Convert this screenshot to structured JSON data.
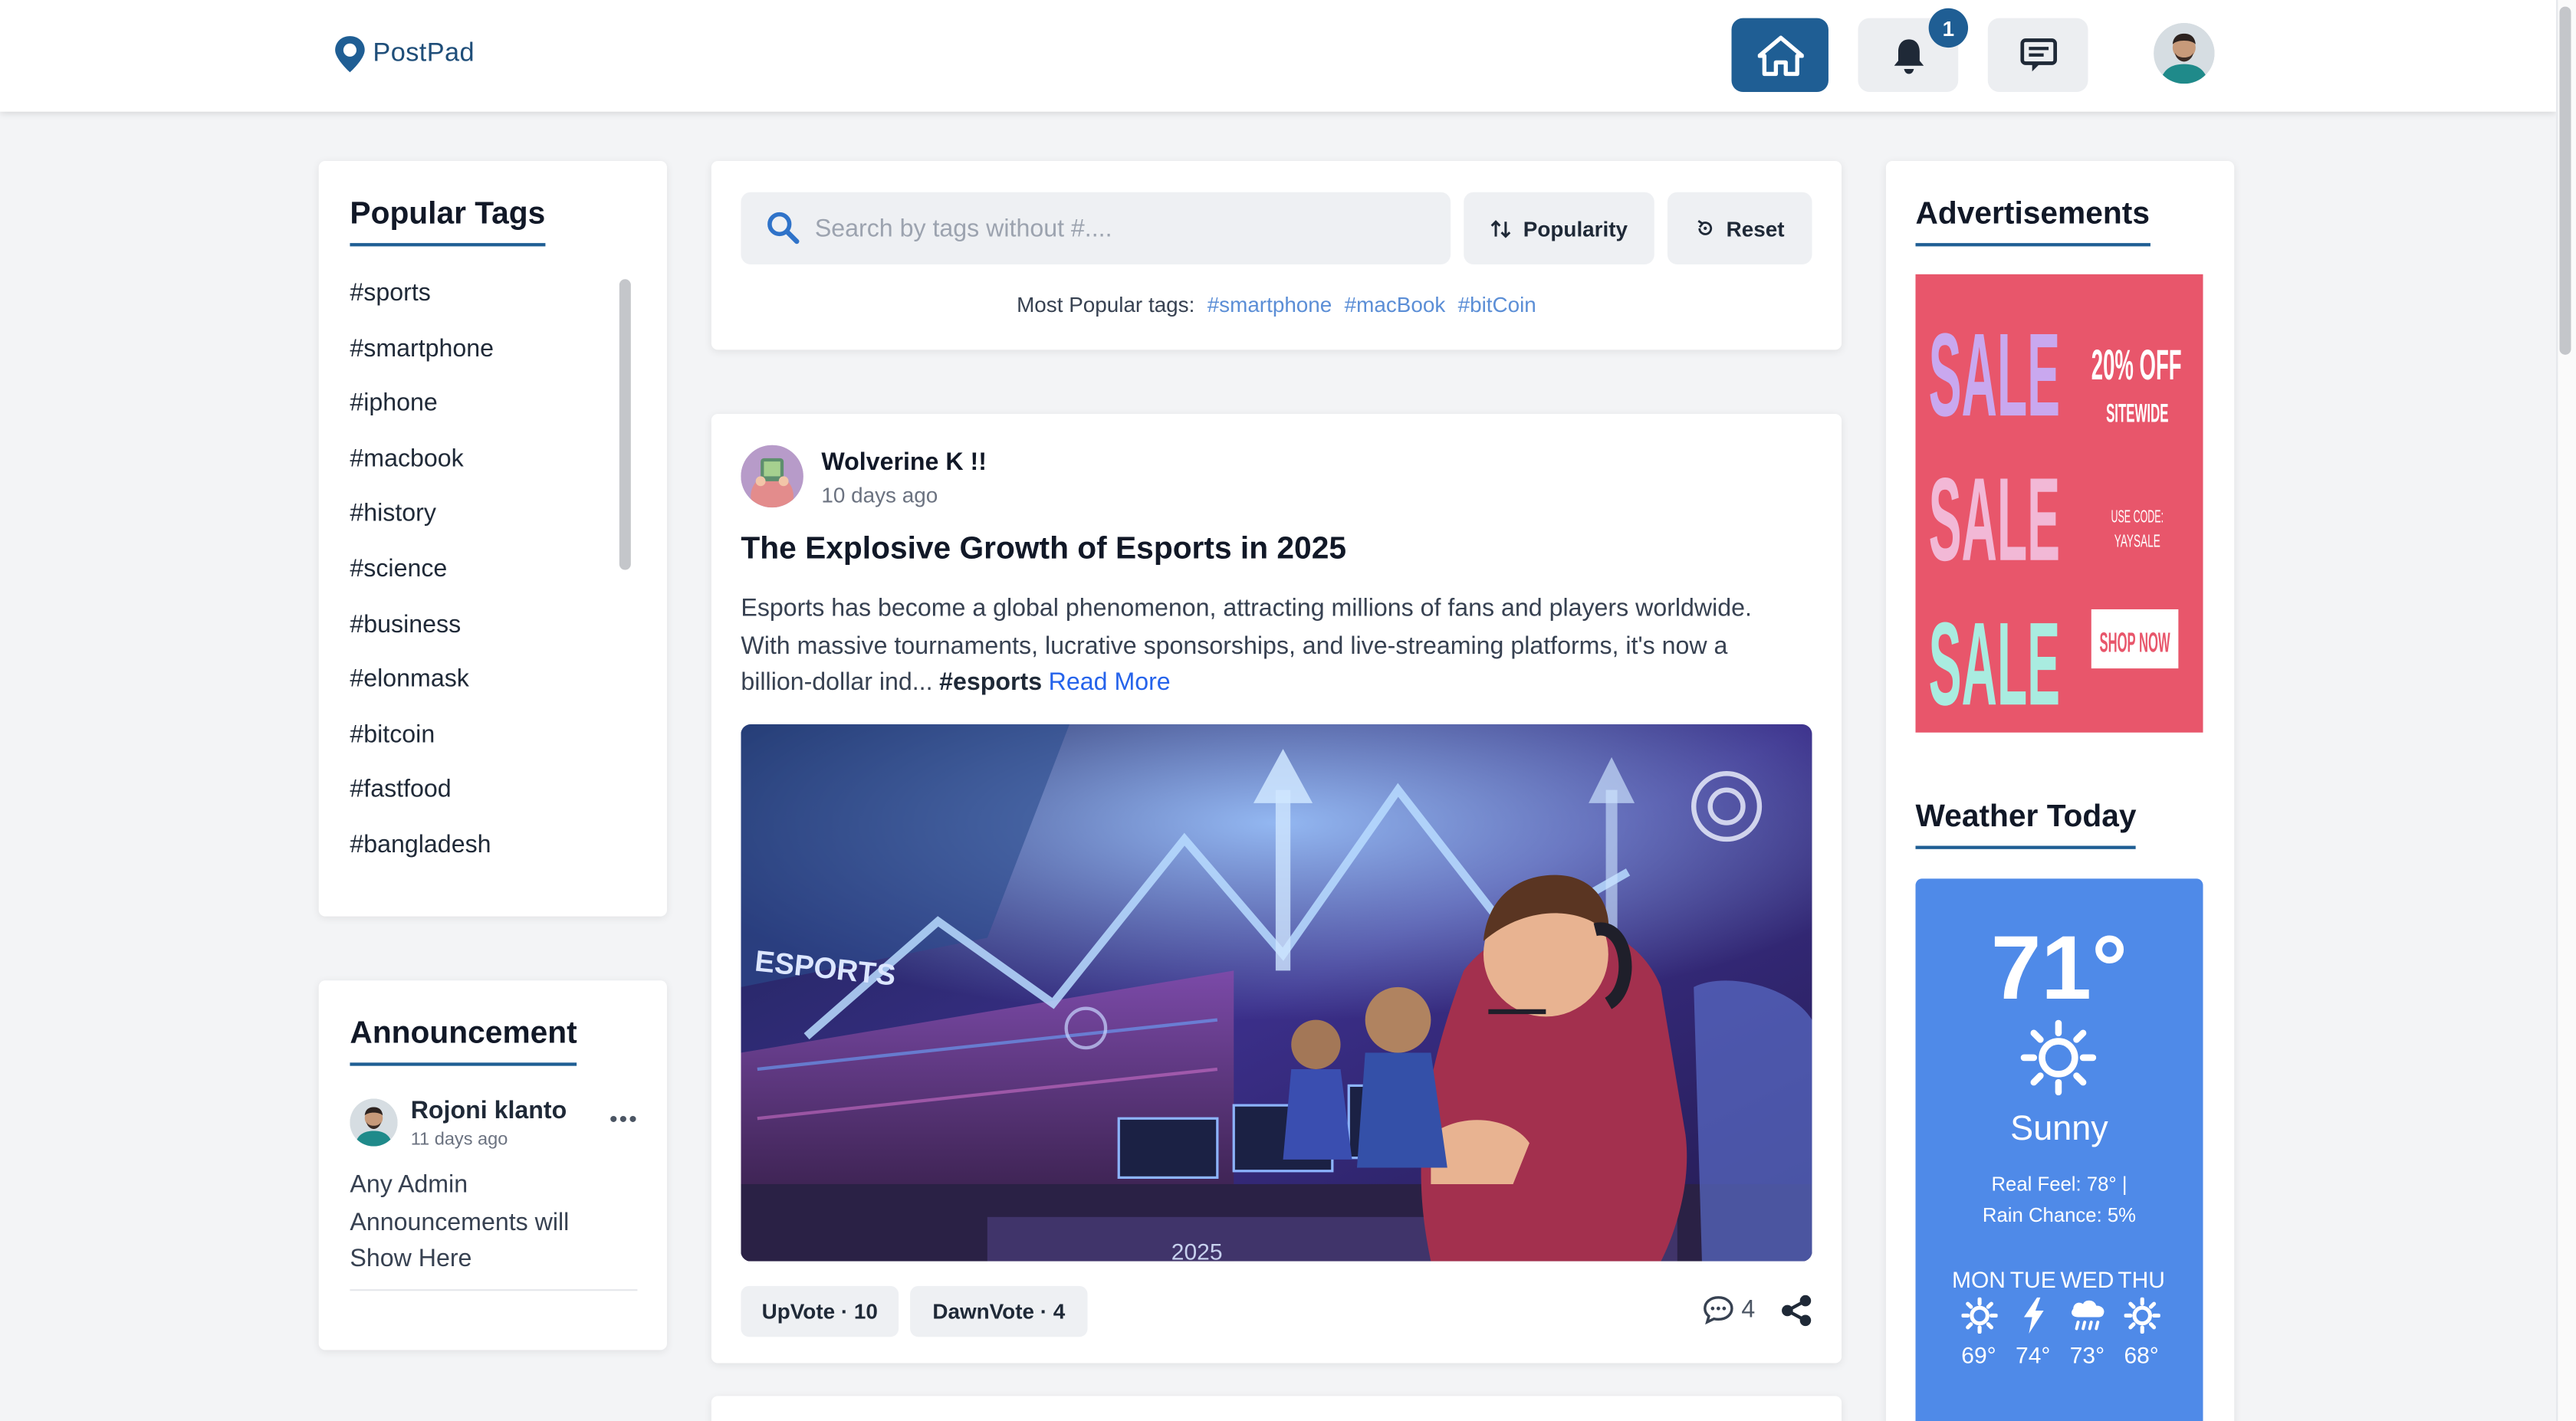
{
  "header": {
    "logo_text": "PostPad",
    "notification_count": "1"
  },
  "sidebar": {
    "tags_title": "Popular Tags",
    "tags": [
      "#sports",
      "#smartphone",
      "#iphone",
      "#macbook",
      "#history",
      "#science",
      "#business",
      "#elonmask",
      "#bitcoin",
      "#fastfood",
      "#bangladesh"
    ],
    "announcement": {
      "title": "Announcement",
      "author": "Rojoni klanto",
      "time": "11 days ago",
      "more": "•••",
      "body": "Any Admin Announcements will Show Here"
    }
  },
  "search": {
    "placeholder": "Search by tags without #....",
    "popularity_label": "Popularity",
    "reset_label": "Reset",
    "popular_prefix": "Most Popular tags:",
    "popular_tags": [
      "#smartphone",
      "#macBook",
      "#bitCoin"
    ]
  },
  "post": {
    "author": "Wolverine K !!",
    "time": "10 days ago",
    "title": "The Explosive Growth of Esports in 2025",
    "body": "Esports has become a global phenomenon, attracting millions of fans and players worldwide. With massive tournaments, lucrative sponsorships, and live-streaming platforms, it's now a billion-dollar ind...",
    "hashtag": "#esports",
    "read_more": "Read More",
    "image_text_1": "ESPORTS",
    "image_text_2": "2025",
    "upvote_label": "UpVote · 10",
    "downvote_label": "DawnVote · 4",
    "comment_count": "4"
  },
  "right": {
    "ads_title": "Advertisements",
    "ad": {
      "sale": "SALE",
      "discount": "20% OFF",
      "sitewide": "SITEWIDE",
      "code_label": "USE CODE:",
      "code": "YAYSALE",
      "shop": "SHOP NOW"
    },
    "weather_title": "Weather Today",
    "weather": {
      "temp": "71°",
      "condition": "Sunny",
      "real_feel": "Real Feel: 78°   |",
      "rain": "Rain Chance: 5%",
      "days": [
        "MON",
        "TUE",
        "WED",
        "THU"
      ],
      "day_icons": [
        "sun-icon",
        "lightning-icon",
        "rain-cloud-icon",
        "sun-icon"
      ],
      "temps": [
        "69°",
        "74°",
        "73°",
        "68°"
      ]
    }
  },
  "colors": {
    "brand": "#1f5e94",
    "link": "#2563eb",
    "weather_bg": "#4f8ae8",
    "ad_bg": "#e8566b"
  }
}
